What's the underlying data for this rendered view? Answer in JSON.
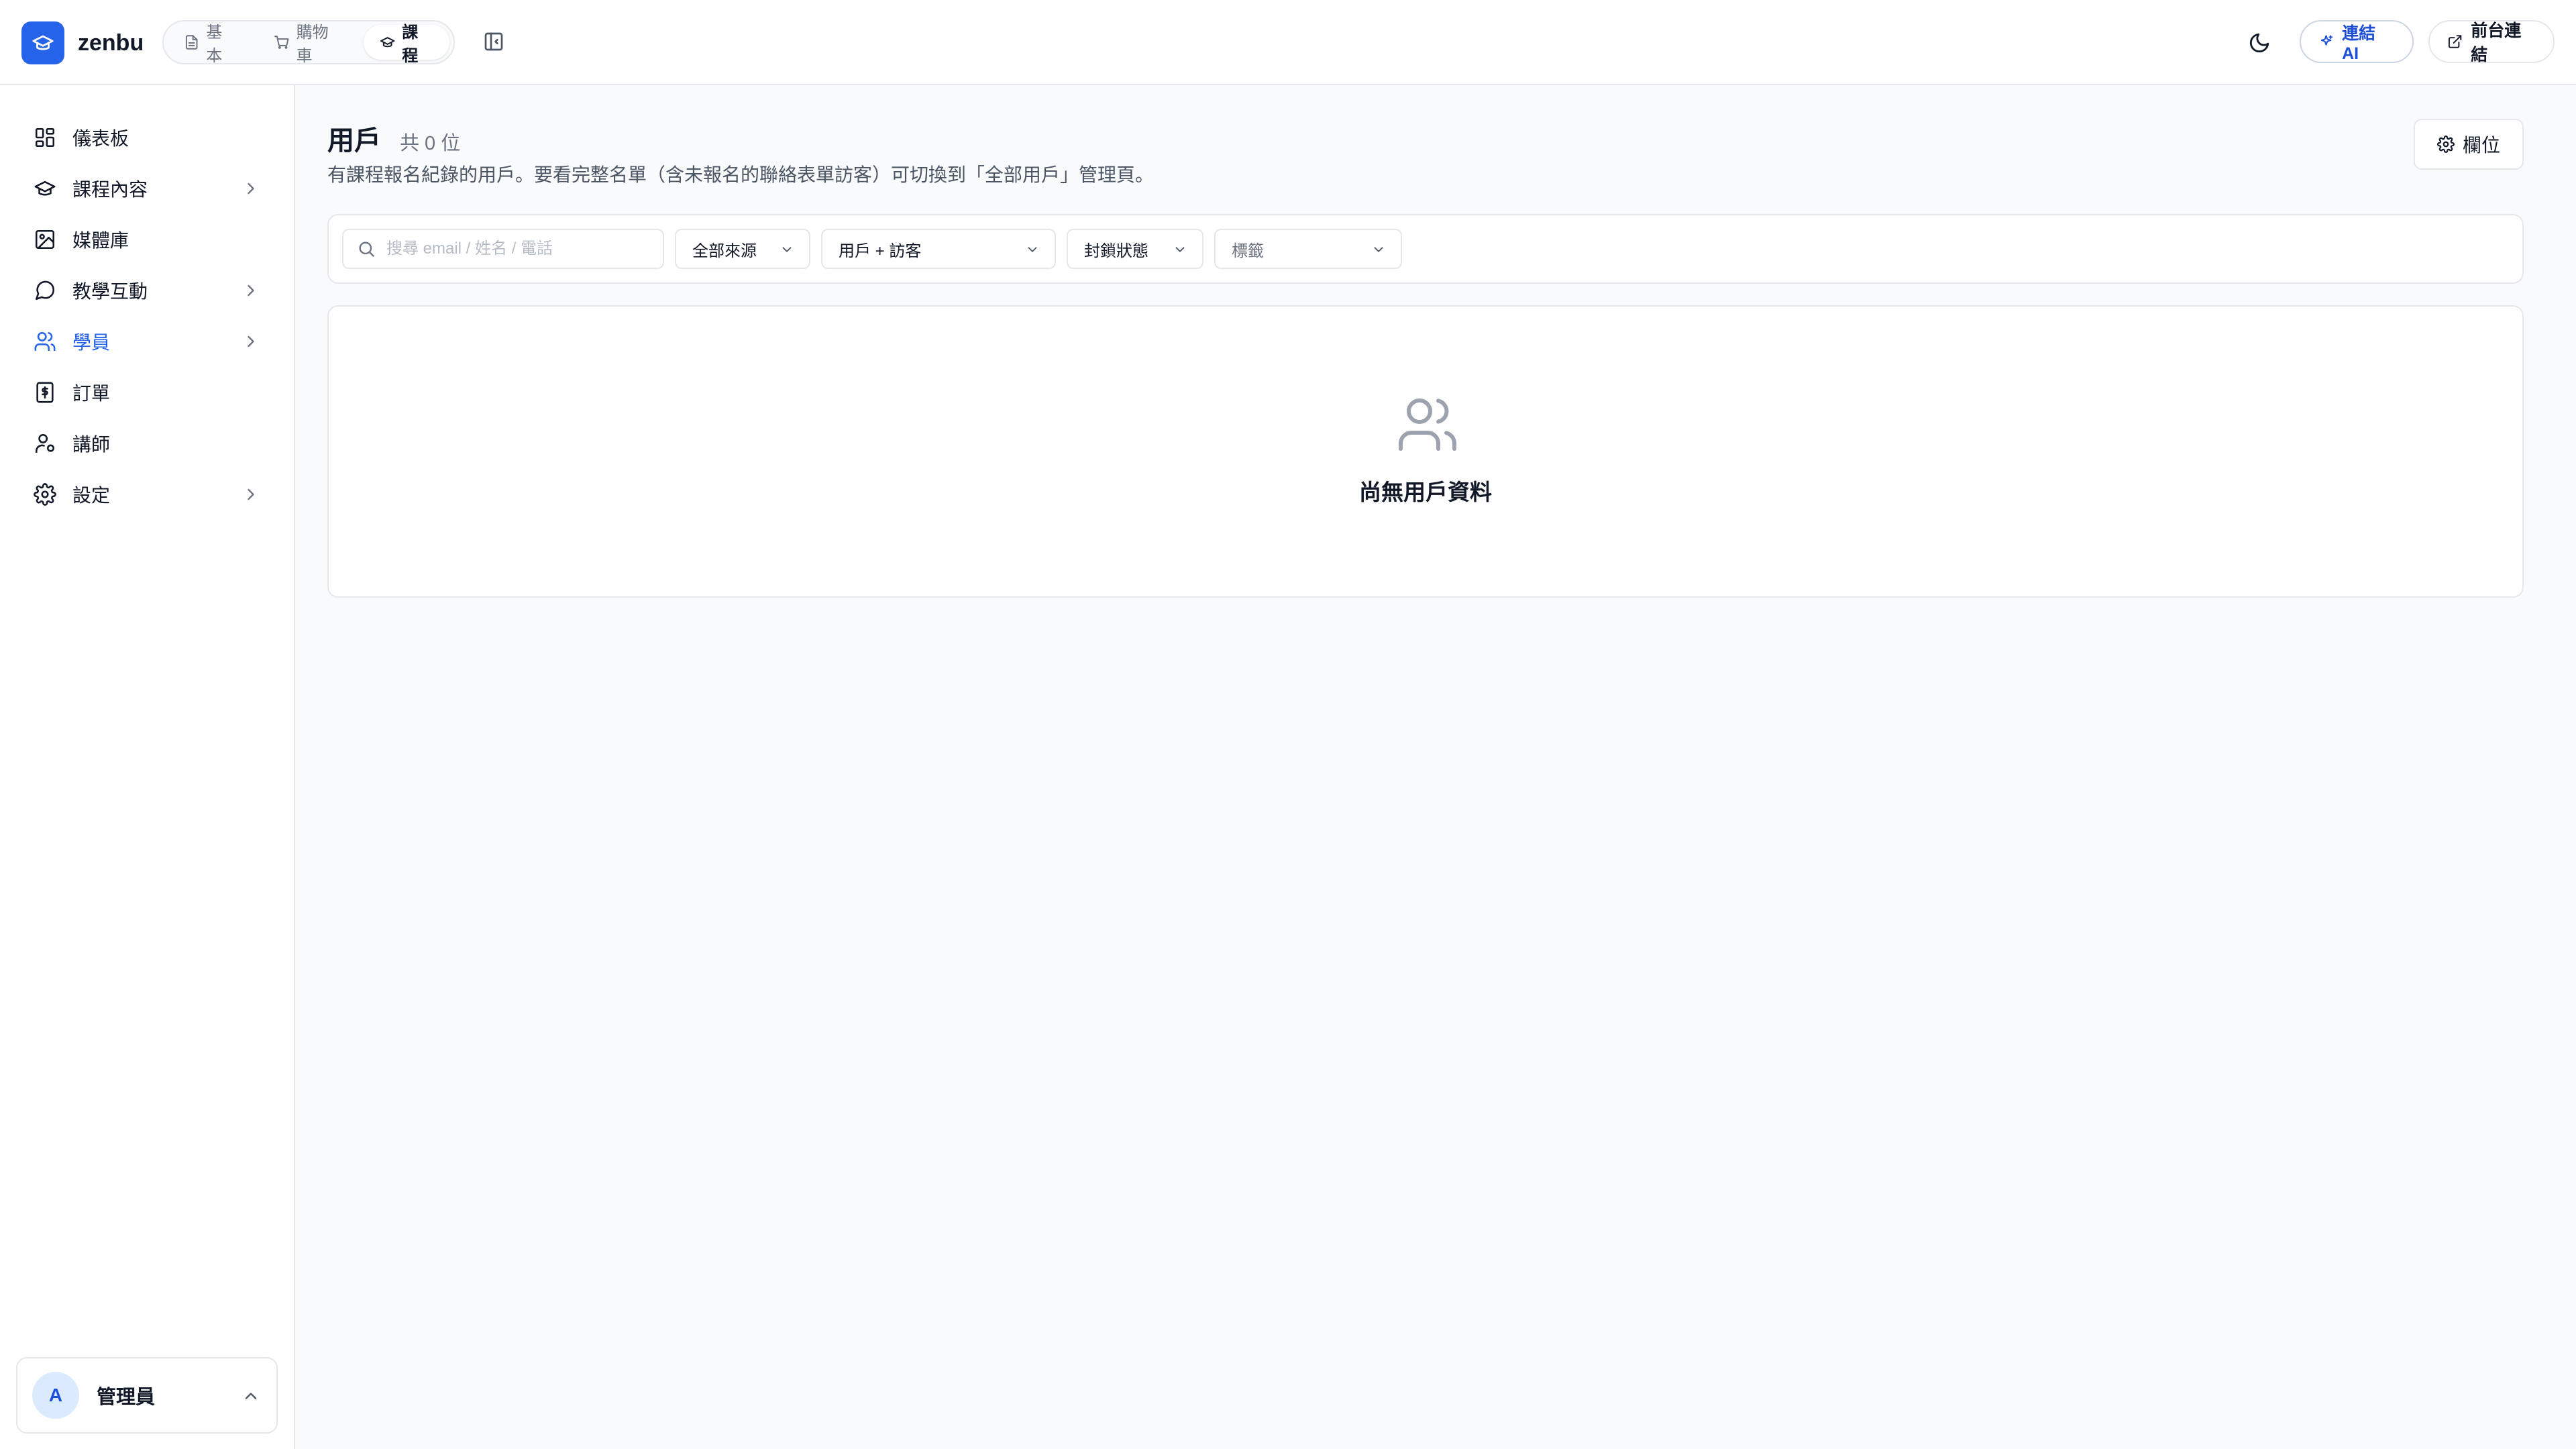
{
  "app": {
    "brand": "zenbu",
    "modes": [
      {
        "label": "基本",
        "icon": "file-icon",
        "active": false
      },
      {
        "label": "購物車",
        "icon": "cart-icon",
        "active": false
      },
      {
        "label": "課程",
        "icon": "graduation-cap-icon",
        "active": true
      }
    ],
    "connect_ai_label": "連結 AI",
    "front_link_label": "前台連結"
  },
  "sidebar": {
    "items": [
      {
        "label": "儀表板",
        "icon": "dashboard-icon",
        "has_children": false,
        "active": false
      },
      {
        "label": "課程內容",
        "icon": "graduation-cap-icon",
        "has_children": true,
        "active": false
      },
      {
        "label": "媒體庫",
        "icon": "image-icon",
        "has_children": false,
        "active": false
      },
      {
        "label": "教學互動",
        "icon": "message-circle-icon",
        "has_children": true,
        "active": false
      },
      {
        "label": "學員",
        "icon": "users-icon",
        "has_children": true,
        "active": true
      },
      {
        "label": "訂單",
        "icon": "receipt-icon",
        "has_children": false,
        "active": false
      },
      {
        "label": "講師",
        "icon": "user-cog-icon",
        "has_children": false,
        "active": false
      },
      {
        "label": "設定",
        "icon": "gear-icon",
        "has_children": true,
        "active": false
      }
    ],
    "user": {
      "initial": "A",
      "name": "管理員"
    }
  },
  "main": {
    "title": "用戶",
    "count": "共 0 位",
    "subtitle": "有課程報名紀錄的用戶。要看完整名單（含未報名的聯絡表單訪客）可切換到「全部用戶」管理頁。",
    "columns_button": "欄位",
    "filters": {
      "search_placeholder": "搜尋 email / 姓名 / 電話",
      "source": "全部來源",
      "user_type": "用戶 + 訪客",
      "block_status": "封鎖狀態",
      "tags_placeholder": "標籤"
    },
    "empty_text": "尚無用戶資料"
  },
  "colors": {
    "accent": "#2563eb",
    "border": "#e5e7eb",
    "background": "#f8fafc"
  }
}
